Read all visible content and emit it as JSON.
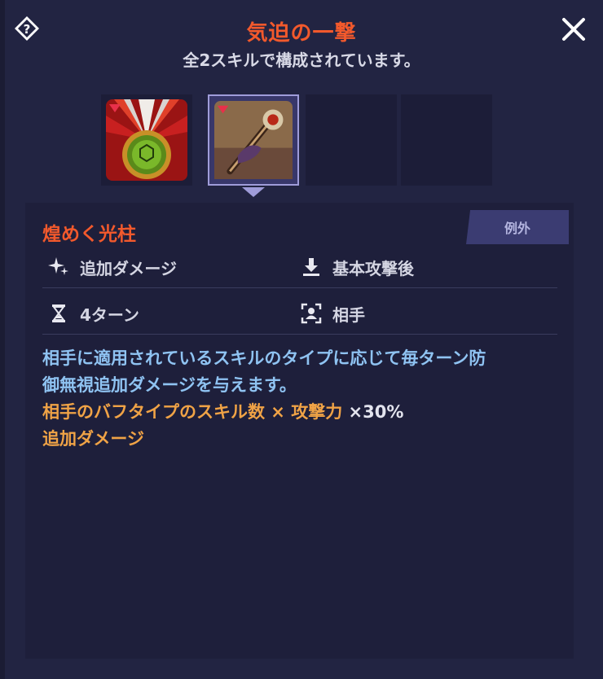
{
  "header": {
    "title": "気迫の一撃",
    "subtitle": "全2スキルで構成されています。"
  },
  "icons": {
    "help": "diamond-question-icon",
    "close": "close-x-icon"
  },
  "skill_slots": [
    {
      "icon": "emblem-orb-skill-icon",
      "selected": false,
      "empty": false
    },
    {
      "icon": "staff-skill-icon",
      "selected": true,
      "empty": false
    },
    {
      "empty": true
    },
    {
      "empty": true
    }
  ],
  "skill": {
    "name": "煌めく光柱",
    "tag": "例外",
    "attributes": {
      "effect": "追加ダメージ",
      "timing": "基本攻撃後",
      "duration": "4ターン",
      "target": "相手"
    },
    "description": {
      "line_blue_1": "相手に適用されているスキルのタイプに応じて毎ターン防",
      "line_blue_2": "御無視追加ダメージを与えます。",
      "formula_part": "相手のバフタイプのスキル数 × 攻撃力",
      "formula_mult": " ×30%",
      "formula_tail": "追加ダメージ"
    }
  },
  "colors": {
    "accent_orange": "#f2592c",
    "desc_blue": "#8fc3f2",
    "desc_orange": "#f0a346"
  }
}
